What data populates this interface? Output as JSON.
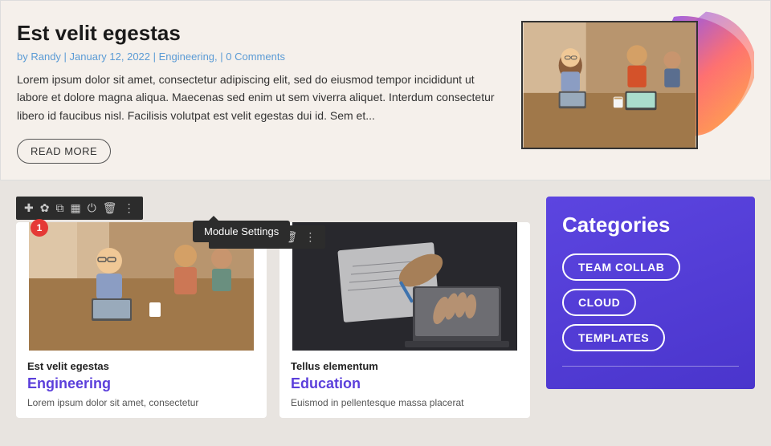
{
  "top_post": {
    "title": "Est velit egestas",
    "meta": {
      "author": "by Randy",
      "date": "January 12, 2022",
      "category": "Engineering,",
      "comments": "0 Comments"
    },
    "body": "Lorem ipsum dolor sit amet, consectetur adipiscing elit, sed do eiusmod tempor incididunt ut labore et dolore magna aliqua. Maecenas sed enim ut sem viverra aliquet. Interdum consectetur libero id faucibus nisl. Facilisis volutpat est velit egestas dui id. Sem et...",
    "read_more": "READ MORE"
  },
  "module_toolbar": {
    "tooltip": "Module Settings",
    "badge": "1"
  },
  "cards": [
    {
      "subtitle": "Est velit egestas",
      "category": "Engineering",
      "body": "Lorem ipsum dolor sit amet, consectetur"
    },
    {
      "subtitle": "Tellus elementum",
      "category": "Education",
      "body": "Euismod in pellentesque massa placerat"
    }
  ],
  "sidebar": {
    "categories_title": "Categories",
    "tags": [
      "TEAM COLLAB",
      "CLOUD",
      "TEMPLATES"
    ]
  },
  "toolbar_icons": [
    "＋",
    "✿",
    "⊞",
    "⊟",
    "⏻",
    "🗑",
    "⋮"
  ]
}
